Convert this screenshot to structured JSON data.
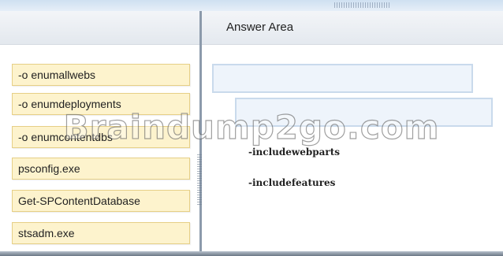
{
  "answer_area": {
    "title": "Answer Area",
    "code_lines": [
      "-includewebparts",
      "-includefeatures"
    ]
  },
  "choices": [
    "-o enumallwebs",
    "-o enumdeployments",
    "-o enumcontentdbs",
    "psconfig.exe",
    "Get-SPContentDatabase",
    "stsadm.exe"
  ],
  "watermark": "Braindump2go.com",
  "colors": {
    "choice_fill": "#fdf3cd",
    "choice_border": "#e6cf86",
    "slot_fill": "#eef4fb",
    "slot_border": "#c9daec",
    "header_band": "#e6eef8"
  }
}
